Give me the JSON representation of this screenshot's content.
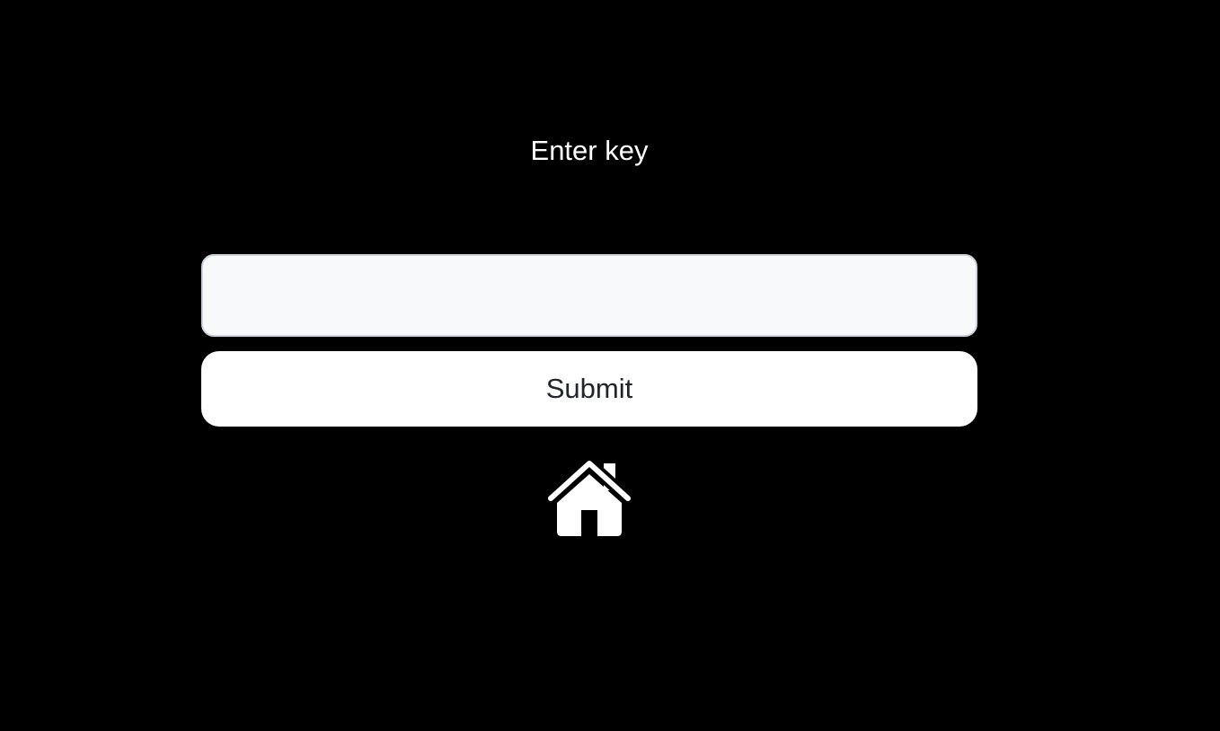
{
  "form": {
    "prompt_label": "Enter key",
    "key_input_value": "",
    "key_input_placeholder": "",
    "submit_label": "Submit"
  },
  "nav": {
    "home_icon": "home-icon"
  },
  "colors": {
    "background": "#000000",
    "text_light": "#ffffff",
    "input_bg": "#f8f9fa",
    "input_border": "#ced4da",
    "button_bg": "#ffffff",
    "button_text": "#212529"
  }
}
